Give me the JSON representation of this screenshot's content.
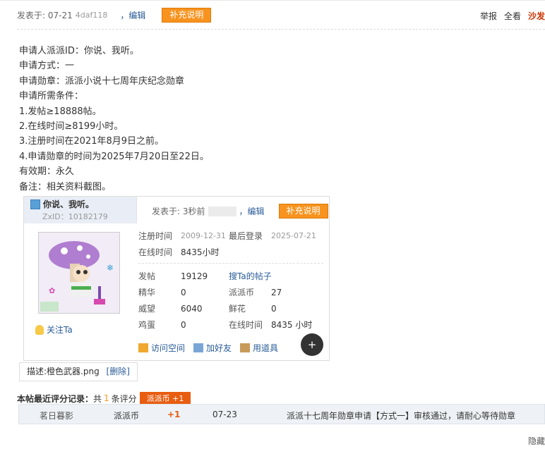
{
  "top": {
    "posted": "发表于: 07-21",
    "hash": "4daf118",
    "edit": "，编辑",
    "supplement": "补充说明",
    "report": "举报",
    "view_all": "全看",
    "sofa": "沙发"
  },
  "content": {
    "lines": [
      "申请人派派ID：你说、我听。",
      "申请方式：一",
      "申请勋章：派派小说十七周年庆纪念勋章",
      "申请所需条件：",
      "1.发帖≥18888帖。",
      "2.在线时间≥8199小时。",
      "3.注册时间在2021年8月9日之前。",
      "4.申请勋章的时间为2025年7月20日至22日。",
      "有效期：永久",
      "备注：相关资料截图。"
    ]
  },
  "shot": {
    "username": "你说、我听。",
    "zxid": "ZxID：10182179",
    "posted": "发表于: 3秒前",
    "edit": "，编辑",
    "supplement": "补充说明",
    "follow": "关注Ta",
    "reg_time_label": "注册时间",
    "reg_time_value": "2009-12-31",
    "last_login_label": "最后登录",
    "last_login_value": "2025-07-21",
    "online_label": "在线时间",
    "online_value": "8435小时",
    "posts_label": "发帖",
    "posts_value": "19129",
    "search_posts": "搜Ta的帖子",
    "digest_label": "精华",
    "digest_value": "0",
    "coin_label": "派派币",
    "coin_value": "27",
    "prestige_label": "威望",
    "prestige_value": "6040",
    "flower_label": "鲜花",
    "flower_value": "0",
    "egg_label": "鸡蛋",
    "egg_value": "0",
    "online2_label": "在线时间",
    "online2_value": "8435 小时",
    "visit_space": "访问空间",
    "add_friend": "加好友",
    "use_item": "用道具"
  },
  "caption": {
    "text": "描述:橙色武器.png",
    "delete": "[删除]"
  },
  "rating": {
    "title": "本帖最近评分记录：",
    "total_prefix": "共",
    "count": "1",
    "total_suffix": "条评分",
    "badge": "派派币 +1",
    "row": {
      "user": "茗日暮影",
      "type": "派派币",
      "value": "+1",
      "date": "07-23",
      "reason": "派派十七周年勋章申请【方式一】审核通过，请耐心等待勋章"
    }
  },
  "hide": "隐藏"
}
